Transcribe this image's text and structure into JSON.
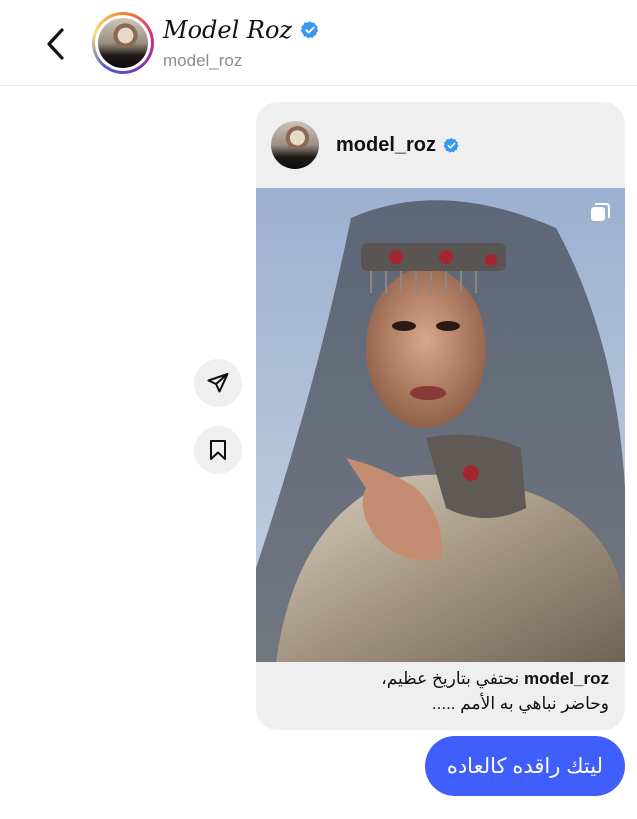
{
  "header": {
    "display_name": "Model Roz",
    "handle": "model_roz"
  },
  "post": {
    "username": "model_roz",
    "caption_user": "model_roz",
    "caption_line1": "نحتفي بتاريخ عظيم،",
    "caption_line2": "وحاضر نباهي به الأمم ....."
  },
  "message": {
    "text": "ليتك راقده كالعاده"
  },
  "colors": {
    "verified": "#3897f0",
    "bubble": "#3f5efb",
    "card_bg": "#efefef"
  },
  "icons": {
    "back": "chevron-left-icon",
    "share": "paper-plane-icon",
    "save": "bookmark-icon",
    "multi": "carousel-icon",
    "verified": "verified-badge-icon"
  }
}
